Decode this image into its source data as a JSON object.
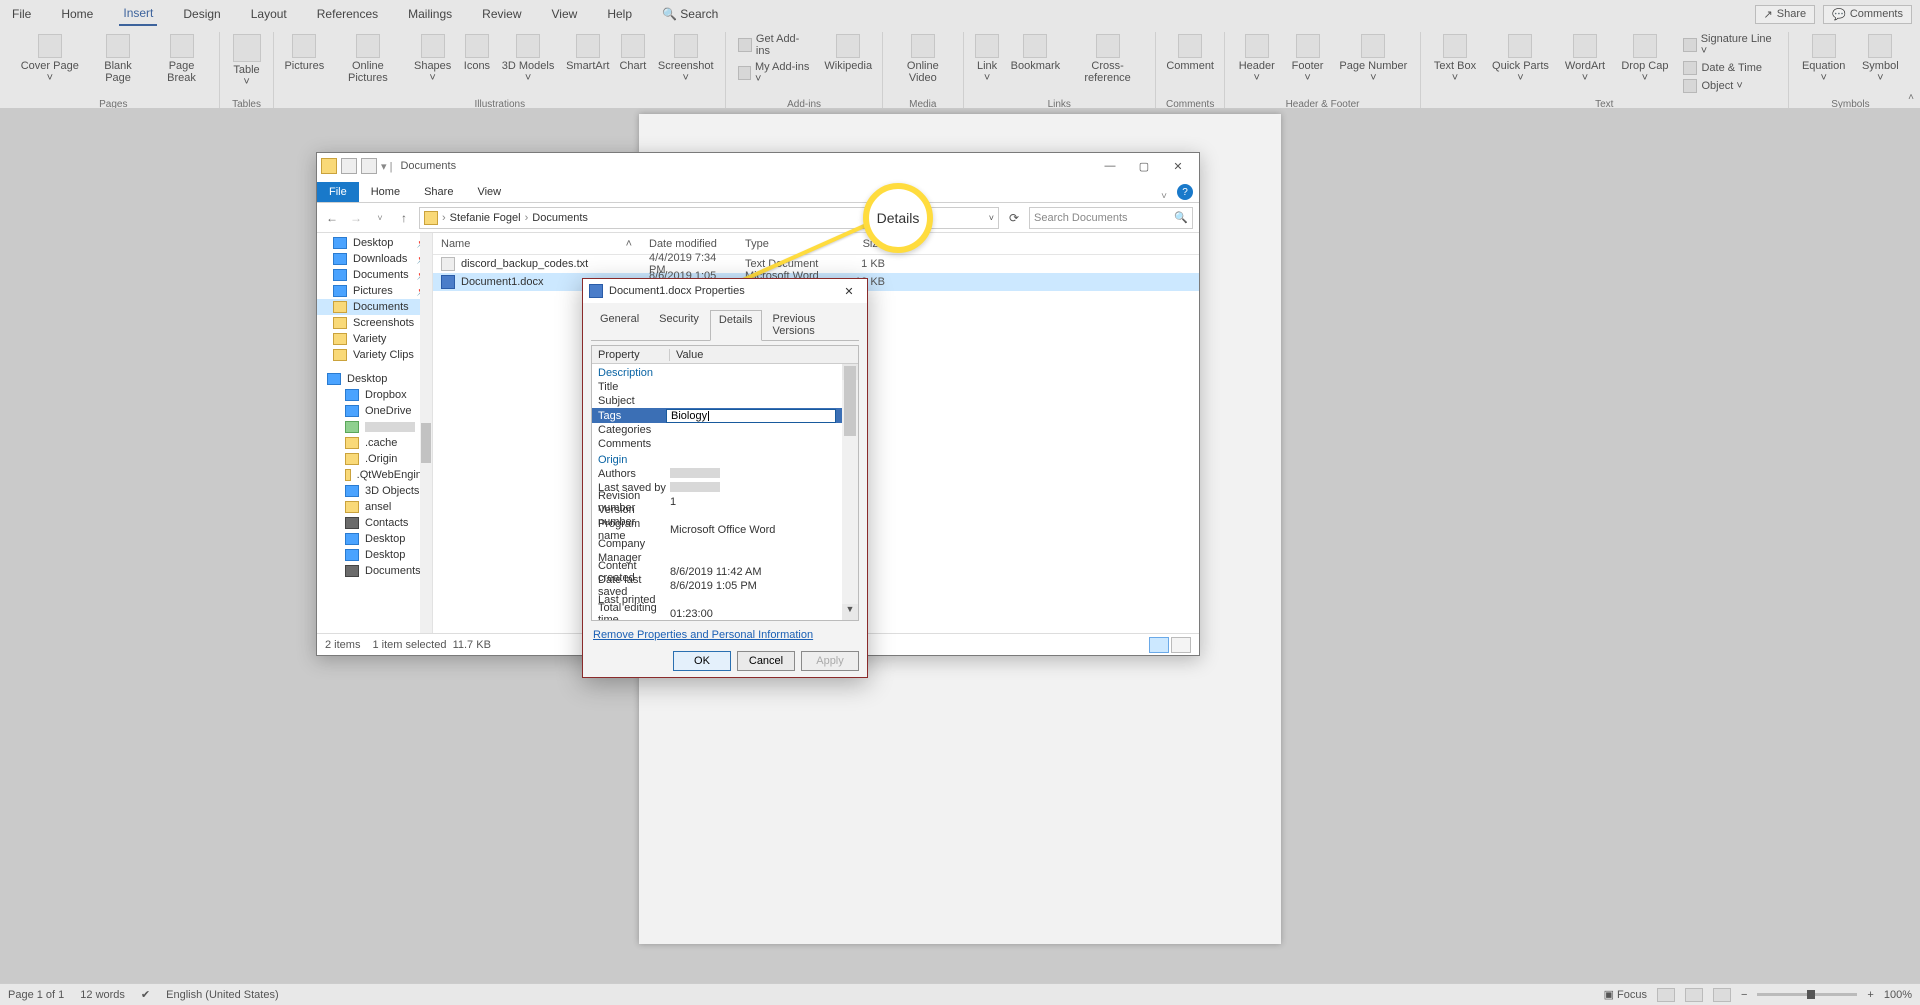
{
  "ribbon": {
    "tabs": [
      "File",
      "Home",
      "Insert",
      "Design",
      "Layout",
      "References",
      "Mailings",
      "Review",
      "View",
      "Help"
    ],
    "active_tab": "Insert",
    "search_label": "Search",
    "share": "Share",
    "comments": "Comments",
    "groups": {
      "pages": {
        "label": "Pages",
        "items": [
          "Cover\nPage ˅",
          "Blank\nPage",
          "Page\nBreak"
        ]
      },
      "tables": {
        "label": "Tables",
        "items": [
          "Table\n˅"
        ]
      },
      "illustrations": {
        "label": "Illustrations",
        "items": [
          "Pictures",
          "Online\nPictures",
          "Shapes\n˅",
          "Icons",
          "3D\nModels ˅",
          "SmartArt",
          "Chart",
          "Screenshot\n˅"
        ]
      },
      "addins": {
        "label": "Add-ins",
        "get": "Get Add-ins",
        "my": "My Add-ins ˅",
        "wiki": "Wikipedia"
      },
      "media": {
        "label": "Media",
        "item": "Online\nVideo"
      },
      "links": {
        "label": "Links",
        "items": [
          "Link\n˅",
          "Bookmark",
          "Cross-\nreference"
        ]
      },
      "comments": {
        "label": "Comments",
        "item": "Comment"
      },
      "hf": {
        "label": "Header & Footer",
        "items": [
          "Header\n˅",
          "Footer\n˅",
          "Page\nNumber ˅"
        ]
      },
      "text": {
        "label": "Text",
        "items": [
          "Text\nBox ˅",
          "Quick\nParts ˅",
          "WordArt\n˅",
          "Drop\nCap ˅"
        ],
        "side": [
          "Signature Line ˅",
          "Date & Time",
          "Object ˅"
        ]
      },
      "symbols": {
        "label": "Symbols",
        "items": [
          "Equation\n˅",
          "Symbol\n˅"
        ]
      }
    }
  },
  "explorer": {
    "qat_title": "Documents",
    "tabs": {
      "file": "File",
      "home": "Home",
      "share": "Share",
      "view": "View"
    },
    "breadcrumb": [
      "Stefanie Fogel",
      "Documents"
    ],
    "search_placeholder": "Search Documents",
    "sidebar": {
      "quick": [
        "Desktop",
        "Downloads",
        "Documents",
        "Pictures",
        "Documents",
        "Screenshots",
        "Variety",
        "Variety Clips"
      ],
      "this_pc_label": "Desktop",
      "places": [
        "Dropbox",
        "OneDrive"
      ],
      "user_items": [
        ".cache",
        ".Origin",
        ".QtWebEngine",
        "3D Objects",
        "ansel",
        "Contacts",
        "Desktop",
        "Desktop",
        "Documents"
      ]
    },
    "columns": {
      "name": "Name",
      "modified": "Date modified",
      "type": "Type",
      "size": "Size"
    },
    "files": [
      {
        "name": "discord_backup_codes.txt",
        "modified": "4/4/2019 7:34 PM",
        "type": "Text Document",
        "size": "1 KB",
        "kind": "txt"
      },
      {
        "name": "Document1.docx",
        "modified": "8/6/2019 1:05 PM",
        "type": "Microsoft Word D...",
        "size": "12 KB",
        "kind": "doc"
      }
    ],
    "status": {
      "count": "2 items",
      "selected": "1 item selected",
      "size": "11.7 KB"
    }
  },
  "callout": {
    "label": "Details"
  },
  "properties": {
    "title": "Document1.docx Properties",
    "tabs": [
      "General",
      "Security",
      "Details",
      "Previous Versions"
    ],
    "active": "Details",
    "columns": {
      "property": "Property",
      "value": "Value"
    },
    "section_description": "Description",
    "fields_desc": {
      "title": "Title",
      "subject": "Subject",
      "tags": "Tags",
      "tags_value": "Biology",
      "categories": "Categories",
      "comments": "Comments"
    },
    "section_origin": "Origin",
    "fields_origin": {
      "authors": "Authors",
      "last_saved_by": "Last saved by",
      "revision": "Revision number",
      "revision_v": "1",
      "version": "Version number",
      "program": "Program name",
      "program_v": "Microsoft Office Word",
      "company": "Company",
      "manager": "Manager",
      "created": "Content created",
      "created_v": "8/6/2019 11:42 AM",
      "saved": "Date last saved",
      "saved_v": "8/6/2019 1:05 PM",
      "printed": "Last printed",
      "editing": "Total editing time",
      "editing_v": "01:23:00"
    },
    "remove_link": "Remove Properties and Personal Information",
    "buttons": {
      "ok": "OK",
      "cancel": "Cancel",
      "apply": "Apply"
    }
  },
  "statusbar": {
    "page": "Page 1 of 1",
    "words": "12 words",
    "lang": "English (United States)",
    "focus": "Focus",
    "zoom": "100%"
  }
}
